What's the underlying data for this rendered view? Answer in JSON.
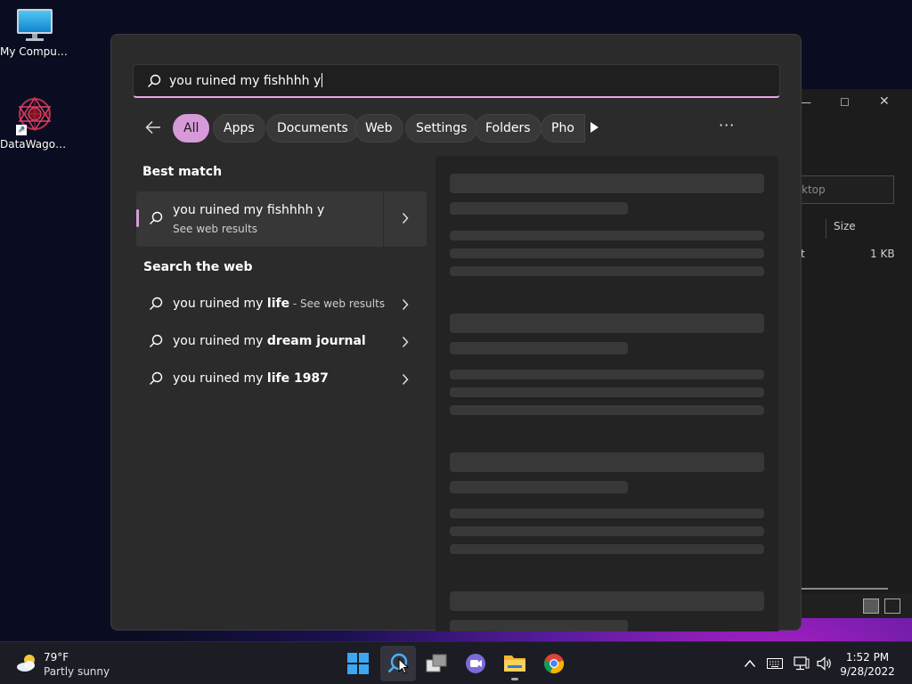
{
  "desktop": {
    "icons": [
      {
        "label": "My Computer"
      },
      {
        "label": "DataWagon..."
      }
    ]
  },
  "explorer": {
    "search_placeholder": "ktop",
    "column_size": "Size",
    "row_type_fragment": "t",
    "row_size": "1 KB"
  },
  "search": {
    "query": "you ruined my fishhhh y",
    "filters": [
      "All",
      "Apps",
      "Documents",
      "Web",
      "Settings",
      "Folders",
      "Pho"
    ],
    "more_label": "···",
    "best_match": {
      "heading": "Best match",
      "title": "you ruined my fishhhh y",
      "subtitle": "See web results"
    },
    "web": {
      "heading": "Search the web",
      "results": [
        {
          "prefix": "you ruined my ",
          "bold": "life",
          "hint": " - See web results"
        },
        {
          "prefix": "you ruined my ",
          "bold": "dream journal",
          "hint": ""
        },
        {
          "prefix": "you ruined my ",
          "bold": "life 1987",
          "hint": ""
        }
      ]
    }
  },
  "taskbar": {
    "weather": {
      "temp": "79°F",
      "condition": "Partly sunny"
    },
    "clock": {
      "time": "1:52 PM",
      "date": "9/28/2022"
    }
  },
  "colors": {
    "accent": "#d79ad9",
    "panel": "#2b2b2b",
    "taskbar": "#1c1c24"
  }
}
